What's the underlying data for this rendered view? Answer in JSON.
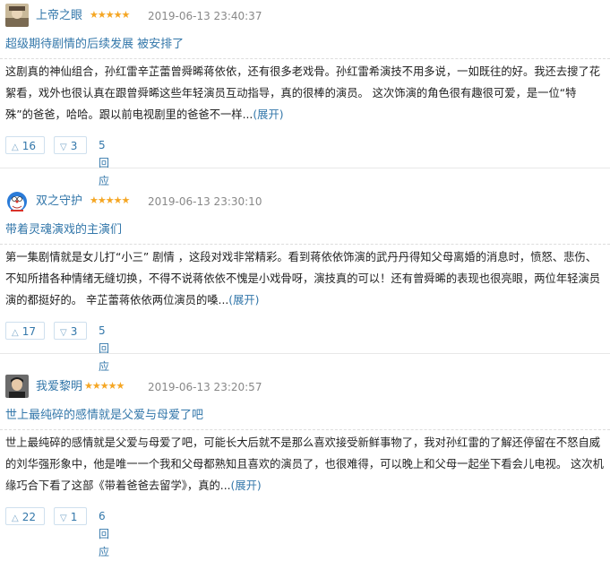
{
  "reviews": [
    {
      "username": "上帝之眼",
      "stars": "★★★★★",
      "date": "2019-06-13 23:40:37",
      "title": "超级期待剧情的后续发展 被安排了",
      "body": "这剧真的神仙组合，孙红雷辛芷蕾曾舜晞蒋依依，还有很多老戏骨。孙红雷希演技不用多说，一如既往的好。我还去搜了花絮看，戏外也很认真在跟曾舜晞这些年轻演员互动指导，真的很棒的演员。 这次饰演的角色很有趣很可爱，是一位“特殊”的爸爸，哈哈。跟以前电视剧里的爸爸不一样...",
      "expand": "(展开)",
      "up_count": "16",
      "down_count": "3",
      "reply": "5回应"
    },
    {
      "username": "双之守护",
      "stars": "★★★★★",
      "date": "2019-06-13 23:30:10",
      "title": "带着灵魂演戏的主演们",
      "body": "第一集剧情就是女儿打“小三” 剧情 ，这段对戏非常精彩。看到蒋依依饰演的武丹丹得知父母离婚的消息时，愤怒、悲伤、不知所措各种情绪无缝切换，不得不说蒋依依不愧是小戏骨呀，演技真的可以！还有曾舜晞的表现也很亮眼，两位年轻演员演的都挺好的。 辛芷蕾蒋依依两位演员的嗓...",
      "expand": "(展开)",
      "up_count": "17",
      "down_count": "3",
      "reply": "5回应"
    },
    {
      "username": "我爱黎明",
      "stars": "★★★★★",
      "date": "2019-06-13 23:20:57",
      "title": "世上最纯碎的感情就是父爱与母爱了吧",
      "body": "世上最纯碎的感情就是父爱与母爱了吧，可能长大后就不是那么喜欢接受新鲜事物了，我对孙红雷的了解还停留在不怒自威的刘华强形象中，他是唯一一个我和父母都熟知且喜欢的演员了，也很难得，可以晚上和父母一起坐下看会儿电视。 这次机缘巧合下看了这部《带着爸爸去留学》，真的...",
      "expand": "(展开)",
      "up_count": "22",
      "down_count": "1",
      "reply": "6回应"
    }
  ],
  "icons": {
    "up": "triangle-up-icon",
    "down": "triangle-down-icon"
  },
  "colors": {
    "link": "#3377aa",
    "star": "#f5a623",
    "date": "#888888"
  }
}
